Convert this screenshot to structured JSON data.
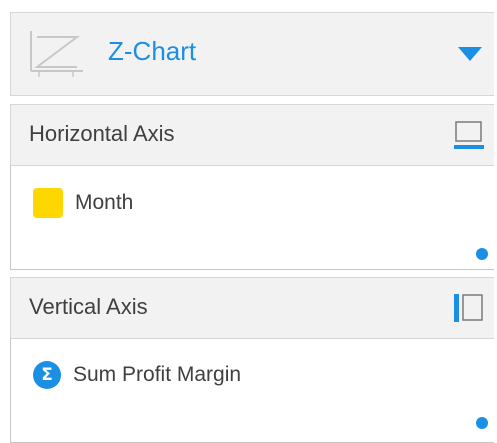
{
  "chart_selector": {
    "title": "Z-Chart",
    "thumbnail_icon": "z-chart-icon",
    "dropdown_icon": "chevron-down-icon"
  },
  "horizontal_axis": {
    "label": "Horizontal Axis",
    "icon": "horizontal-axis-icon",
    "fields": [
      {
        "label": "Month",
        "icon": "dimension-swatch-icon",
        "color": "#ffd700"
      }
    ]
  },
  "vertical_axis": {
    "label": "Vertical Axis",
    "icon": "vertical-axis-icon",
    "fields": [
      {
        "label": "Sum Profit Margin",
        "icon": "sigma-icon",
        "glyph": "Σ",
        "color": "#1a8fe3"
      }
    ]
  },
  "colors": {
    "accent": "#1a8fe3",
    "header_bg": "#f2f2f2",
    "text": "#404040",
    "dimension": "#ffd700"
  }
}
